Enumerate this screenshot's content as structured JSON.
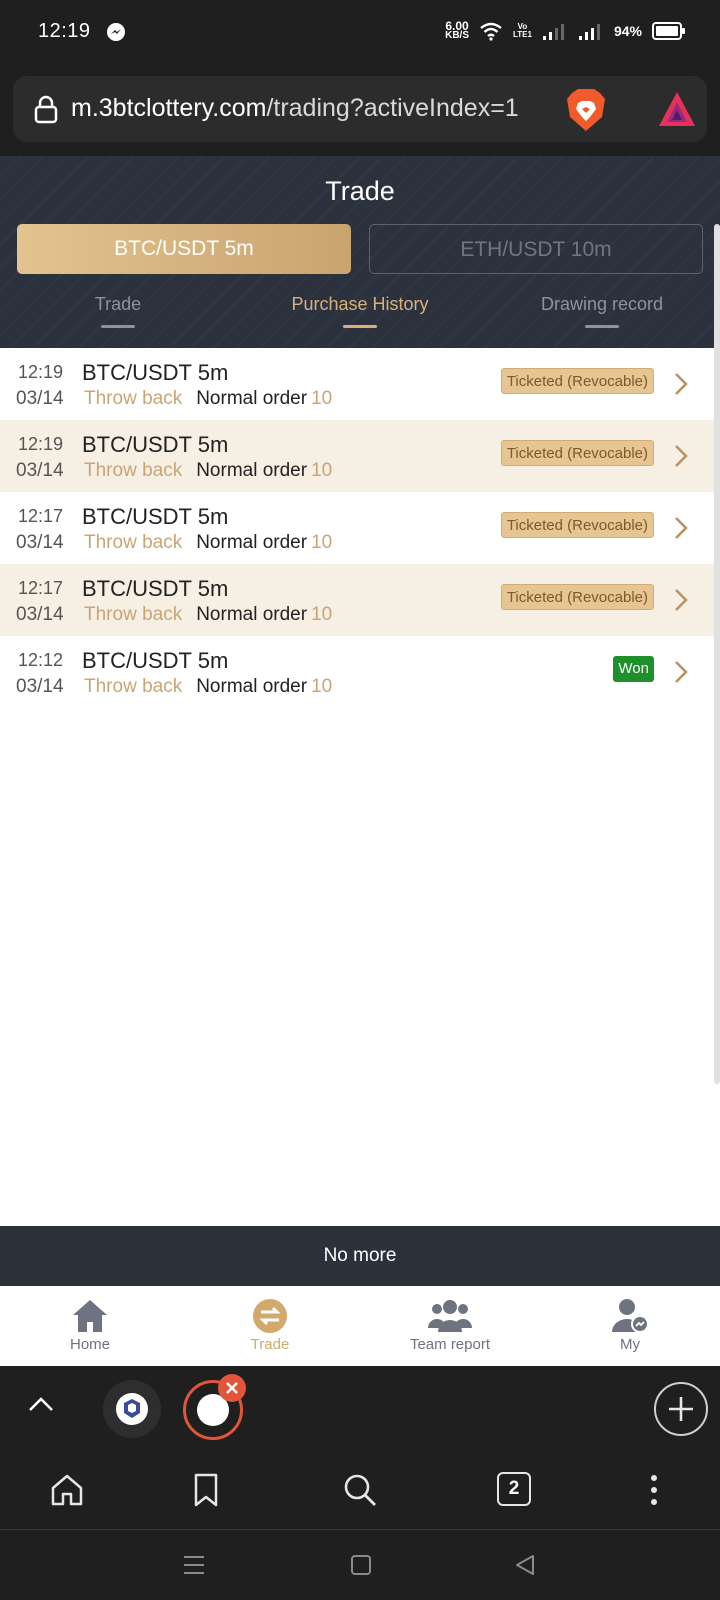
{
  "status_bar": {
    "time": "12:19",
    "net_speed_value": "6.00",
    "net_speed_unit": "KB/S",
    "volte_top": "Vo",
    "volte_bottom": "LTE1",
    "battery": "94%"
  },
  "browser": {
    "url_host": "m.3btclottery.com",
    "url_path": "/trading?activeIndex=1",
    "tab_count": "2"
  },
  "page": {
    "title": "Trade",
    "pairs": [
      {
        "label": "BTC/USDT 5m",
        "active": true
      },
      {
        "label": "ETH/USDT 10m",
        "active": false
      }
    ],
    "subtabs": [
      {
        "label": "Trade"
      },
      {
        "label": "Purchase History"
      },
      {
        "label": "Drawing record"
      }
    ],
    "orders": [
      {
        "time": "12:19",
        "date": "03/14",
        "pair": "BTC/USDT 5m",
        "action": "Throw back",
        "order_type": "Normal order",
        "amount": "10",
        "status": "Ticketed (Revocable)"
      },
      {
        "time": "12:19",
        "date": "03/14",
        "pair": "BTC/USDT 5m",
        "action": "Throw back",
        "order_type": "Normal order",
        "amount": "10",
        "status": "Ticketed (Revocable)"
      },
      {
        "time": "12:17",
        "date": "03/14",
        "pair": "BTC/USDT 5m",
        "action": "Throw back",
        "order_type": "Normal order",
        "amount": "10",
        "status": "Ticketed (Revocable)"
      },
      {
        "time": "12:17",
        "date": "03/14",
        "pair": "BTC/USDT 5m",
        "action": "Throw back",
        "order_type": "Normal order",
        "amount": "10",
        "status": "Ticketed (Revocable)"
      },
      {
        "time": "12:12",
        "date": "03/14",
        "pair": "BTC/USDT 5m",
        "action": "Throw back",
        "order_type": "Normal order",
        "amount": "10",
        "status": "Won"
      }
    ],
    "end_text": "No more"
  },
  "app_nav": {
    "items": [
      {
        "label": "Home"
      },
      {
        "label": "Trade"
      },
      {
        "label": "Team report"
      },
      {
        "label": "My"
      }
    ]
  },
  "colors": {
    "accent_gold": "#d2a96d",
    "header_bg": "#2c323d",
    "won_green": "#1d8f2b",
    "ticket_bg": "#e7c590"
  }
}
